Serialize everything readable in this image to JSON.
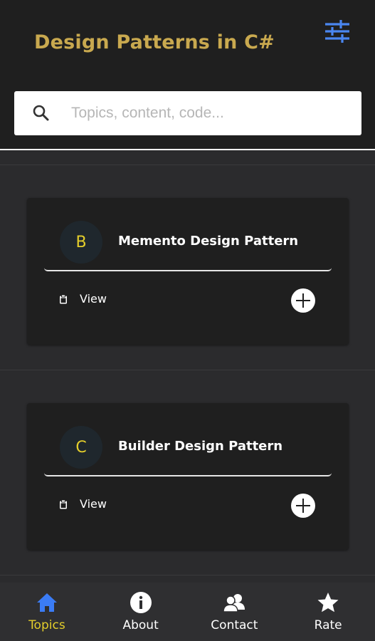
{
  "header": {
    "title": "Design Patterns in C#",
    "filter_icon": "sliders-icon",
    "title_color": "#c9a94f"
  },
  "search": {
    "placeholder": "Topics, content, code...",
    "value": "",
    "icon": "search-icon"
  },
  "cards": [
    {
      "avatar_letter": "B",
      "title": "Memento Design Pattern",
      "view_label": "View",
      "view_icon": "clipboard-icon",
      "add_icon": "plus-circle-icon"
    },
    {
      "avatar_letter": "C",
      "title": "Builder Design Pattern",
      "view_label": "View",
      "view_icon": "clipboard-icon",
      "add_icon": "plus-circle-icon"
    }
  ],
  "bottom_nav": {
    "items": [
      {
        "label": "Topics",
        "icon": "home-icon",
        "active": true
      },
      {
        "label": "About",
        "icon": "info-icon",
        "active": false
      },
      {
        "label": "Contact",
        "icon": "contacts-icon",
        "active": false
      },
      {
        "label": "Rate",
        "icon": "star-icon",
        "active": false
      }
    ],
    "active_color": "#e4ce2b",
    "active_icon_color": "#3b7cf5"
  }
}
